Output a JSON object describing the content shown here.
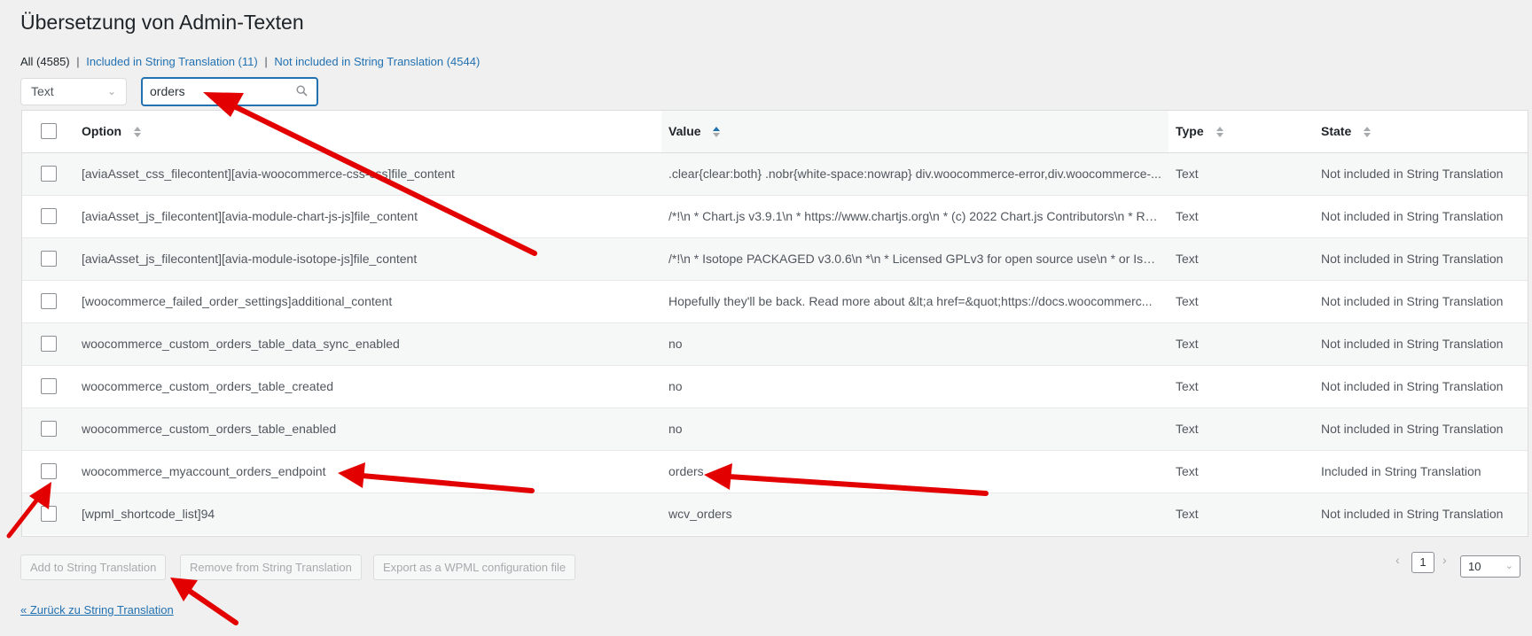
{
  "page_title": "Übersetzung von Admin-Texten",
  "filters": {
    "all": "All (4585)",
    "included": "Included in String Translation (11)",
    "not_included": "Not included in String Translation (4544)",
    "separator": "|"
  },
  "type_select": {
    "value": "Text"
  },
  "search": {
    "value": "orders",
    "icon": "search-icon"
  },
  "table": {
    "headers": {
      "option": "Option",
      "value": "Value",
      "type": "Type",
      "state": "State"
    },
    "sorted_column": "value",
    "rows": [
      {
        "option": "[aviaAsset_css_filecontent][avia-woocommerce-css-css]file_content",
        "value": ".clear{clear:both} .nobr{white-space:nowrap} div.woocommerce-error,div.woocommerce-...",
        "type": "Text",
        "state": "Not included in String Translation"
      },
      {
        "option": "[aviaAsset_js_filecontent][avia-module-chart-js-js]file_content",
        "value": "/*!\\n * Chart.js v3.9.1\\n * https://www.chartjs.org\\n * (c) 2022 Chart.js Contributors\\n * Re...",
        "type": "Text",
        "state": "Not included in String Translation"
      },
      {
        "option": "[aviaAsset_js_filecontent][avia-module-isotope-js]file_content",
        "value": "/*!\\n * Isotope PACKAGED v3.0.6\\n *\\n * Licensed GPLv3 for open source use\\n * or Isoto...",
        "type": "Text",
        "state": "Not included in String Translation"
      },
      {
        "option": "[woocommerce_failed_order_settings]additional_content",
        "value": "Hopefully they'll be back. Read more about &lt;a href=&quot;https://docs.woocommerc...",
        "type": "Text",
        "state": "Not included in String Translation"
      },
      {
        "option": "woocommerce_custom_orders_table_data_sync_enabled",
        "value": "no",
        "type": "Text",
        "state": "Not included in String Translation"
      },
      {
        "option": "woocommerce_custom_orders_table_created",
        "value": "no",
        "type": "Text",
        "state": "Not included in String Translation"
      },
      {
        "option": "woocommerce_custom_orders_table_enabled",
        "value": "no",
        "type": "Text",
        "state": "Not included in String Translation"
      },
      {
        "option": "woocommerce_myaccount_orders_endpoint",
        "value": "orders",
        "type": "Text",
        "state": "Included in String Translation"
      },
      {
        "option": "[wpml_shortcode_list]94",
        "value": "wcv_orders",
        "type": "Text",
        "state": "Not included in String Translation"
      }
    ]
  },
  "actions": {
    "add": "Add to String Translation",
    "remove": "Remove from String Translation",
    "export": "Export as a WPML configuration file"
  },
  "pagination": {
    "prev": "‹",
    "page": "1",
    "next": "›",
    "per_page": "10"
  },
  "back_link": "« Zurück zu String Translation",
  "colors": {
    "accent": "#2271b1",
    "annotation_arrow": "#e30000"
  }
}
